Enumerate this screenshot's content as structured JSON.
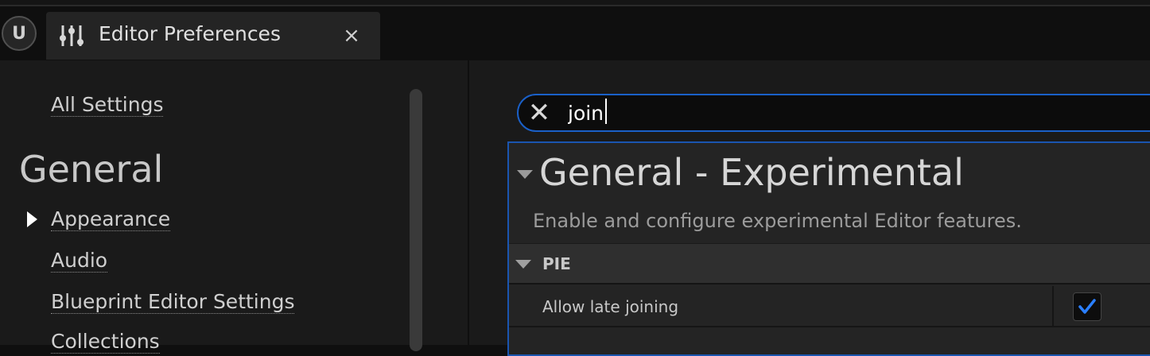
{
  "window": {
    "tab_title": "Editor Preferences",
    "close_glyph": "×",
    "logo_glyph": "U"
  },
  "sidebar": {
    "all_settings": "All Settings",
    "section_title": "General",
    "items": [
      {
        "label": "Appearance",
        "expanded_arrow": true
      },
      {
        "label": "Audio"
      },
      {
        "label": "Blueprint Editor Settings"
      },
      {
        "label": "Collections"
      }
    ]
  },
  "search": {
    "clear_glyph": "✕",
    "value": "join"
  },
  "details": {
    "category_title": "General - Experimental",
    "category_description": "Enable and configure experimental Editor features.",
    "subcategory": "PIE",
    "property": {
      "label": "Allow late joining",
      "checked": true
    }
  },
  "colors": {
    "accent": "#1a60c8",
    "check": "#2a7fff"
  }
}
